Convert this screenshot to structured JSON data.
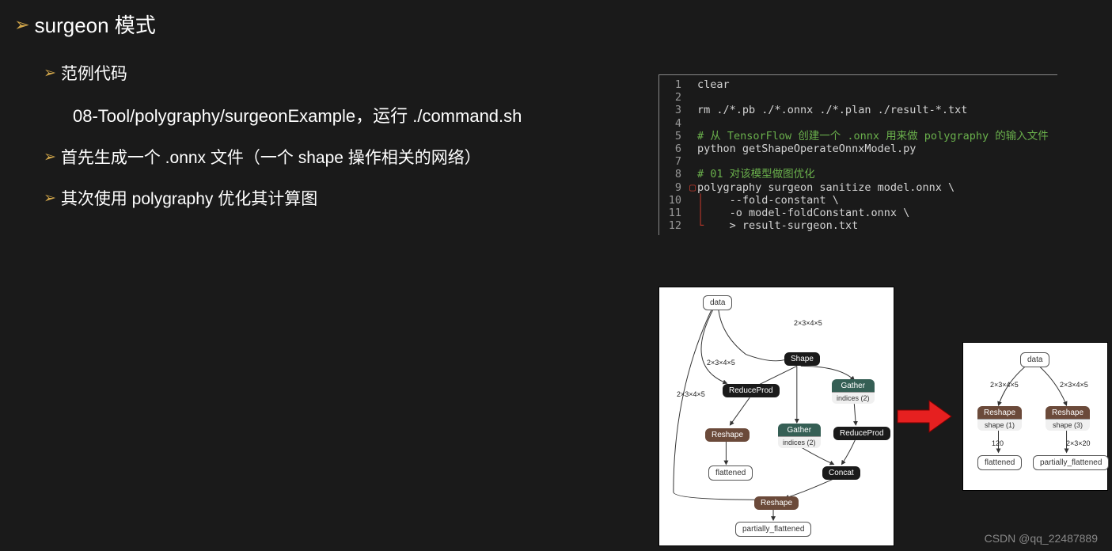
{
  "title": "surgeon 模式",
  "bullets": {
    "b1": "范例代码",
    "b1_text": "08-Tool/polygraphy/surgeonExample，运行 ./command.sh",
    "b2": "首先生成一个 .onnx 文件（一个 shape 操作相关的网络）",
    "b3": "其次使用 polygraphy 优化其计算图"
  },
  "code": {
    "l1": "clear",
    "l2": "",
    "l3": "rm ./*.pb ./*.onnx ./*.plan ./result-*.txt",
    "l4": "",
    "l5": "# 从 TensorFlow 创建一个 .onnx 用来做 polygraphy 的输入文件",
    "l6": "python getShapeOperateOnnxModel.py",
    "l7": "",
    "l8": "# 01 对该模型做图优化",
    "l9": "polygraphy surgeon sanitize model.onnx \\",
    "l10": "    --fold-constant \\",
    "l11": "    -o model-foldConstant.onnx \\",
    "l12": "    > result-surgeon.txt"
  },
  "graph_left": {
    "data": "data",
    "shape": "Shape",
    "reduceprod1": "ReduceProd",
    "gather1": "Gather",
    "gather1_sub": "indices (2)",
    "reshape1": "Reshape",
    "gather2": "Gather",
    "gather2_sub": "indices (2)",
    "reduceprod2": "ReduceProd",
    "flattened": "flattened",
    "concat": "Concat",
    "reshape2": "Reshape",
    "pflat": "partially_flattened",
    "edge1": "2×3×4×5",
    "edge2": "2×3×4×5",
    "edge3": "2×3×4×5"
  },
  "graph_right": {
    "data": "data",
    "reshape1": "Reshape",
    "reshape1_sub": "shape (1)",
    "reshape2": "Reshape",
    "reshape2_sub": "shape (3)",
    "flattened": "flattened",
    "pflat": "partially_flattened",
    "edge1": "2×3×4×5",
    "edge2": "2×3×4×5",
    "edge3": "120",
    "edge4": "2×3×20"
  },
  "watermark": "CSDN @qq_22487889"
}
